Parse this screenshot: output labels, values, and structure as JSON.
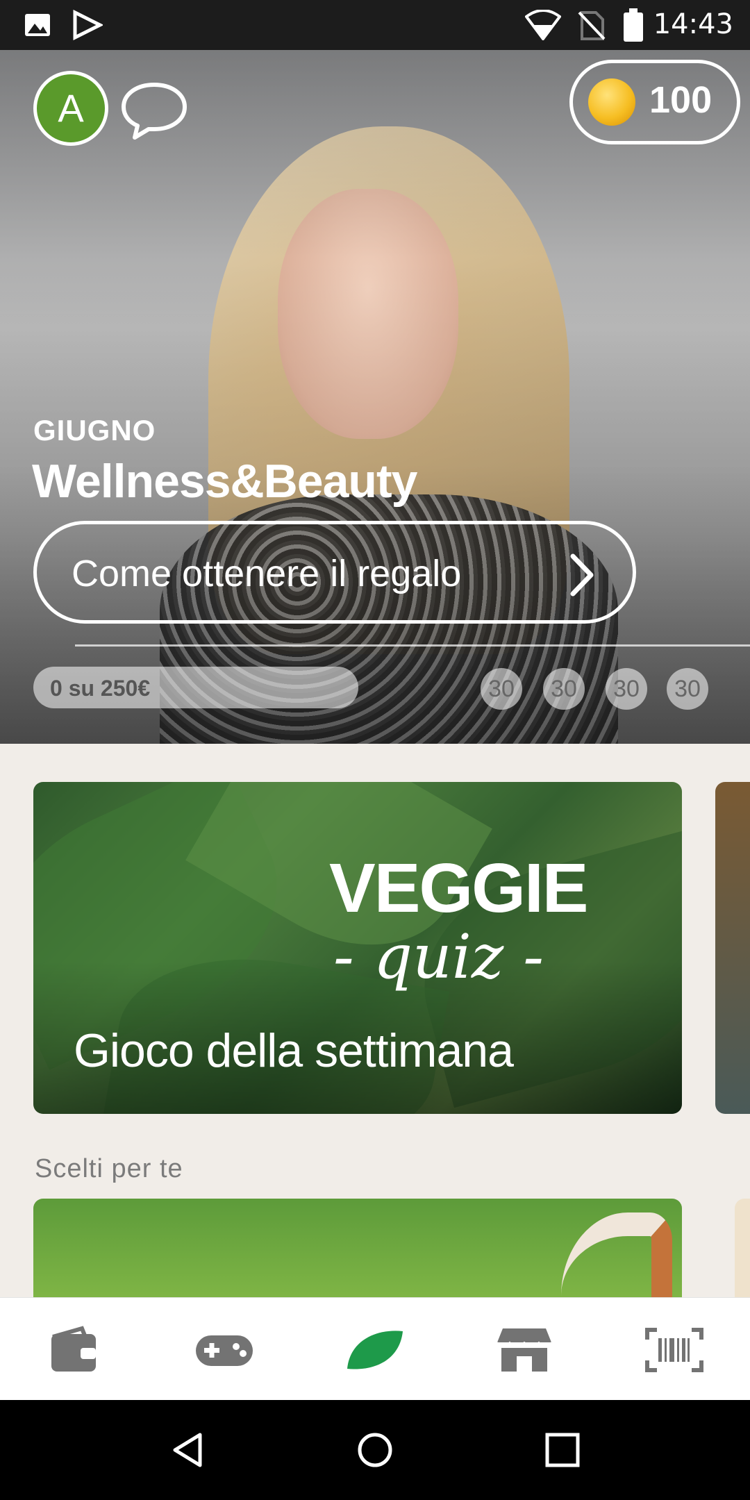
{
  "status_bar": {
    "time": "14:43"
  },
  "header": {
    "avatar_letter": "A",
    "coins": "100"
  },
  "hero": {
    "month": "GIUGNO",
    "campaign": "Wellness&Beauty",
    "cta_label": "Come ottenere il regalo",
    "progress_text": "0 su 250€",
    "milestones": [
      "30",
      "30",
      "30",
      "30"
    ]
  },
  "game_card": {
    "logo_line1": "VEGGIE",
    "logo_line2": "- quiz -",
    "title": "Gioco della settimana"
  },
  "section": {
    "title": "Scelti per te"
  },
  "bottom_nav": [
    "wallet-icon",
    "gamepad-icon",
    "leaf-icon",
    "store-icon",
    "barcode-scan-icon"
  ],
  "colors": {
    "avatar": "#5a9a2b",
    "leaf_active": "#1e9a4a",
    "coin": "#f6be23"
  }
}
